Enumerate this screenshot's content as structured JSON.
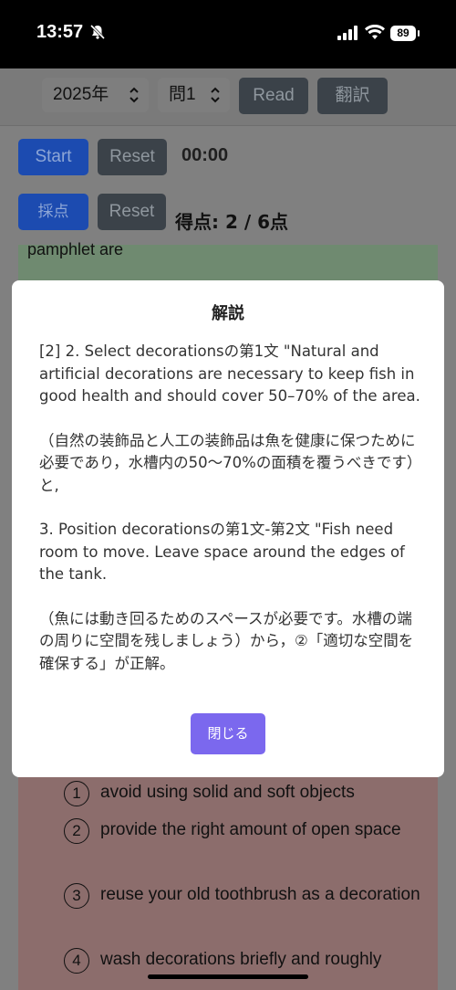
{
  "status_bar": {
    "time": "13:57",
    "battery": "89"
  },
  "toolbar": {
    "year_select": "2025年",
    "question_select": "問1",
    "read_label": "Read",
    "translate_label": "翻訳"
  },
  "timer_controls": {
    "start_label": "Start",
    "reset_label": "Reset",
    "time": "00:00"
  },
  "grading": {
    "grade_label": "採点",
    "reset_label": "Reset",
    "score": "得点: 2 / 6点"
  },
  "question": {
    "partial_text": "pamphlet are"
  },
  "modal": {
    "title": "解説",
    "paragraphs": [
      "[2] 2. Select decorationsの第1文 \"Natural and artificial decorations are necessary to keep fish in good health and should cover 50–70% of the area.",
      "（自然の装飾品と人工の装飾品は魚を健康に保つために必要であり，水槽内の50〜70%の面積を覆うべきです）と,",
      "3. Position decorationsの第1文-第2文 \"Fish need room to move. Leave space around the edges of the tank.",
      "（魚には動き回るためのスペースが必要です。水槽の端の周りに空間を残しましょう）から，②「適切な空間を確保する」が正解。"
    ],
    "close_label": "閉じる"
  },
  "options": [
    {
      "num": "1",
      "text": "avoid using solid and soft objects"
    },
    {
      "num": "2",
      "text": "provide the right amount of open space"
    },
    {
      "num": "3",
      "text": "reuse your old toothbrush as a decoration"
    },
    {
      "num": "4",
      "text": "wash decorations briefly and roughly"
    }
  ]
}
